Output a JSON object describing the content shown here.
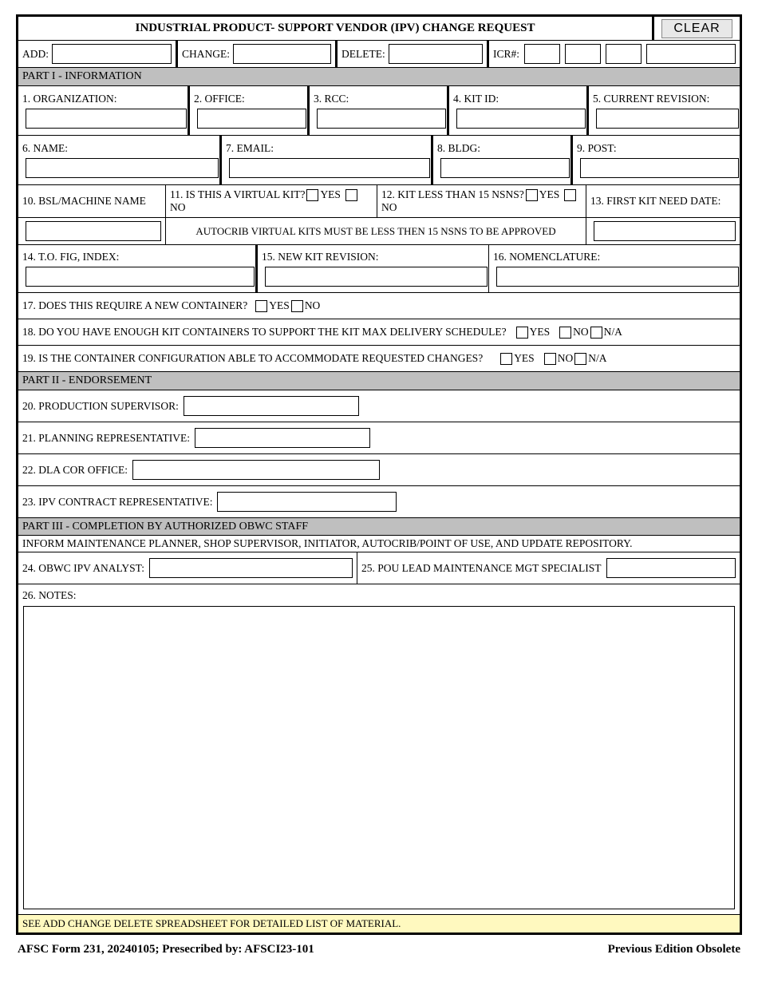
{
  "header": {
    "title": "INDUSTRIAL PRODUCT- SUPPORT VENDOR (IPV) CHANGE REQUEST",
    "clear_btn": "CLEAR"
  },
  "top": {
    "add": "ADD:",
    "change": "CHANGE:",
    "delete": "DELETE:",
    "icr": "ICR#:"
  },
  "part1_hdr": "PART I - INFORMATION",
  "f1": "1. ORGANIZATION:",
  "f2": "2. OFFICE:",
  "f3": "3. RCC:",
  "f4": "4. KIT ID:",
  "f5": "5. CURRENT REVISION:",
  "f6": "6. NAME:",
  "f7": "7. EMAIL:",
  "f8": "8. BLDG:",
  "f9": "9. POST:",
  "f10": "10. BSL/MACHINE NAME",
  "f11": "11. IS THIS A VIRTUAL KIT?",
  "f12": "12. KIT LESS THAN 15 NSNS?",
  "f13": "13. FIRST KIT NEED DATE:",
  "autocrib_hint": "AUTOCRIB VIRTUAL KITS MUST BE LESS THEN 15 NSNS TO BE APPROVED",
  "f14": "14. T.O. FIG, INDEX:",
  "f15": "15. NEW KIT REVISION:",
  "f16": "16. NOMENCLATURE:",
  "f17": "17. DOES THIS REQUIRE A NEW CONTAINER?",
  "f18": "18. DO YOU HAVE ENOUGH KIT CONTAINERS TO SUPPORT THE KIT MAX DELIVERY SCHEDULE?",
  "f19": "19.  IS THE CONTAINER CONFIGURATION ABLE TO ACCOMMODATE REQUESTED CHANGES?",
  "yes": "YES",
  "no": "NO",
  "na": "N/A",
  "part2_hdr": "PART II - ENDORSEMENT",
  "f20": "20. PRODUCTION SUPERVISOR:",
  "f21": "21. PLANNING REPRESENTATIVE:",
  "f22": "22. DLA COR OFFICE:",
  "f23": "23. IPV CONTRACT REPRESENTATIVE:",
  "part3_hdr": "PART III - COMPLETION BY AUTHORIZED OBWC STAFF",
  "part3_note": "INFORM MAINTENANCE  PLANNER, SHOP SUPERVISOR, INITIATOR, AUTOCRIB/POINT OF USE, AND UPDATE REPOSITORY.",
  "f24": "24. OBWC IPV ANALYST:",
  "f25": "25. POU LEAD MAINTENANCE MGT SPECIALIST",
  "f26": "26. NOTES:",
  "yellow_bar": "SEE ADD CHANGE DELETE SPREADSHEET FOR DETAILED LIST OF MATERIAL.",
  "footer_left": "AFSC Form 231, 20240105;  Presecribed by: AFSCI23-101",
  "footer_right": "Previous Edition Obsolete"
}
